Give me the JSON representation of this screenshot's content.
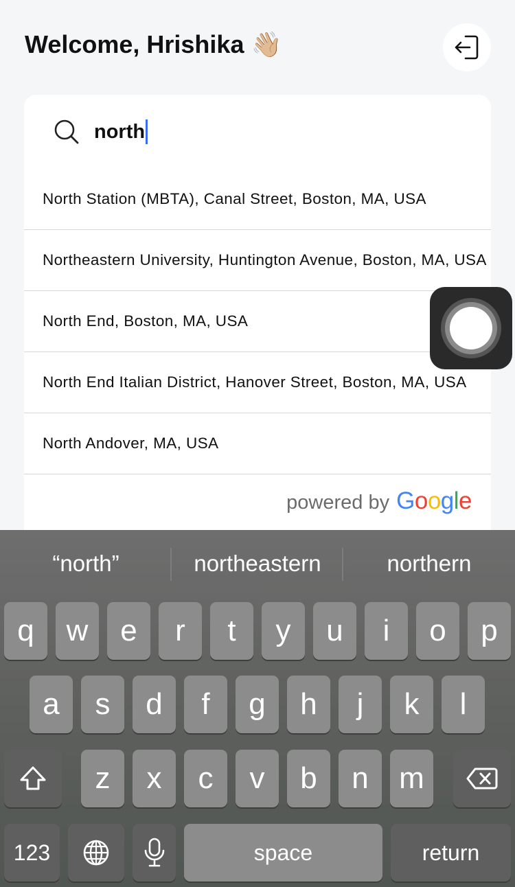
{
  "header": {
    "welcome_text": "Welcome, Hrishika",
    "wave_emoji": "👋🏼",
    "logout_icon": "logout-icon"
  },
  "search": {
    "value": "north",
    "icon": "search-icon"
  },
  "suggestions": [
    "North Station (MBTA), Canal Street, Boston, MA, USA",
    "Northeastern University, Huntington Avenue, Boston, MA, USA",
    "North End, Boston, MA, USA",
    "North End Italian District, Hanover Street, Boston, MA, USA",
    "North Andover, MA, USA"
  ],
  "attribution": {
    "powered_by": "powered by",
    "google_letters": [
      "G",
      "o",
      "o",
      "g",
      "l",
      "e"
    ]
  },
  "keyboard": {
    "predictions": [
      "“north”",
      "northeastern",
      "northern"
    ],
    "row1": [
      "q",
      "w",
      "e",
      "r",
      "t",
      "y",
      "u",
      "i",
      "o",
      "p"
    ],
    "row2": [
      "a",
      "s",
      "d",
      "f",
      "g",
      "h",
      "j",
      "k",
      "l"
    ],
    "row3": [
      "z",
      "x",
      "c",
      "v",
      "b",
      "n",
      "m"
    ],
    "numbers_label": "123",
    "space_label": "space",
    "return_label": "return",
    "shift_icon": "shift-icon",
    "delete_icon": "delete-icon",
    "globe_icon": "globe-icon",
    "mic_icon": "microphone-icon"
  },
  "colors": {
    "caret": "#3a6cf4",
    "google_blue": "#4285f4",
    "google_red": "#ea4335",
    "google_yellow": "#fbbc05",
    "google_green": "#34a853"
  }
}
